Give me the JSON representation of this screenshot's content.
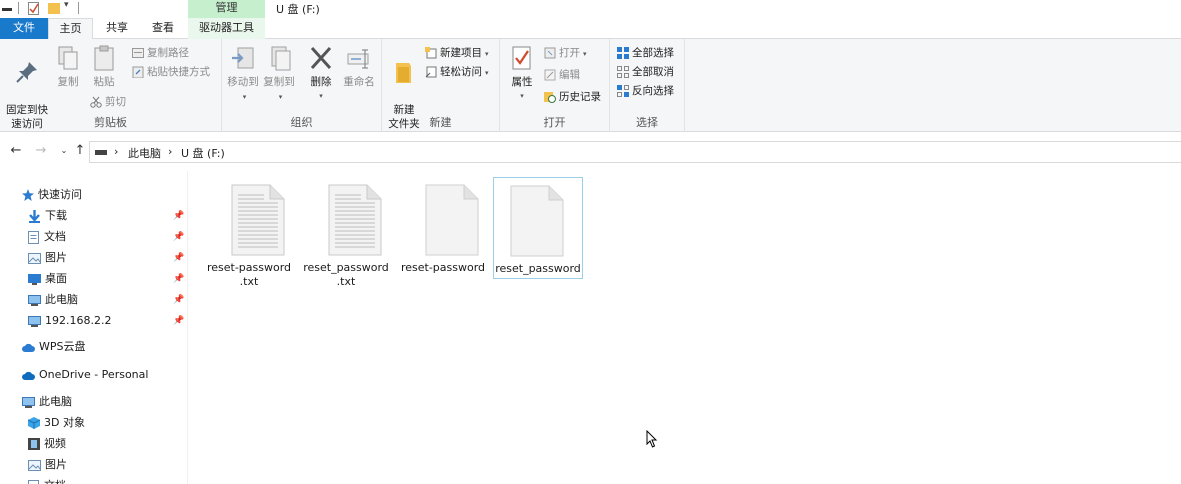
{
  "window": {
    "title": "U 盘 (F:)"
  },
  "contextual_tab": {
    "label": "管理"
  },
  "tabs": {
    "file": "文件",
    "home": "主页",
    "share": "共享",
    "view": "查看",
    "drive_tools": "驱动器工具"
  },
  "ribbon": {
    "clipboard": {
      "label": "剪贴板",
      "pin_quick_access": "固定到快\n速访问",
      "copy": "复制",
      "paste": "粘贴",
      "copy_path": "复制路径",
      "paste_shortcut": "粘贴快捷方式",
      "cut": "剪切"
    },
    "organize": {
      "label": "组织",
      "move_to": "移动到",
      "copy_to": "复制到",
      "delete": "删除",
      "rename": "重命名"
    },
    "new": {
      "label": "新建",
      "new_folder": "新建\n文件夹",
      "new_item": "新建项目",
      "easy_access": "轻松访问"
    },
    "open": {
      "label": "打开",
      "properties": "属性",
      "open": "打开",
      "edit": "编辑",
      "history": "历史记录"
    },
    "select": {
      "label": "选择",
      "select_all": "全部选择",
      "select_none": "全部取消",
      "invert": "反向选择"
    }
  },
  "address": {
    "this_pc": "此电脑",
    "drive": "U 盘 (F:)"
  },
  "nav": {
    "quick_access": "快速访问",
    "downloads": "下载",
    "documents": "文档",
    "pictures": "图片",
    "desktop": "桌面",
    "this_pc_pinned": "此电脑",
    "network_ip": "192.168.2.2",
    "wps": "WPS云盘",
    "onedrive": "OneDrive - Personal",
    "this_pc": "此电脑",
    "objects3d": "3D 对象",
    "videos": "视频",
    "pictures2": "图片",
    "documents2": "文档"
  },
  "files": [
    {
      "name": "reset-password\n.txt",
      "type": "text",
      "selected": false
    },
    {
      "name": "reset_password\n.txt",
      "type": "text",
      "selected": false
    },
    {
      "name": "reset-password",
      "type": "blank",
      "selected": false
    },
    {
      "name": "reset_password",
      "type": "blank",
      "selected": true
    }
  ],
  "colors": {
    "file_tab": "#1979ca",
    "manage_tab": "#c6efce",
    "selection_border": "#9ccfe9",
    "folder_yellow": "#f2c14e"
  }
}
